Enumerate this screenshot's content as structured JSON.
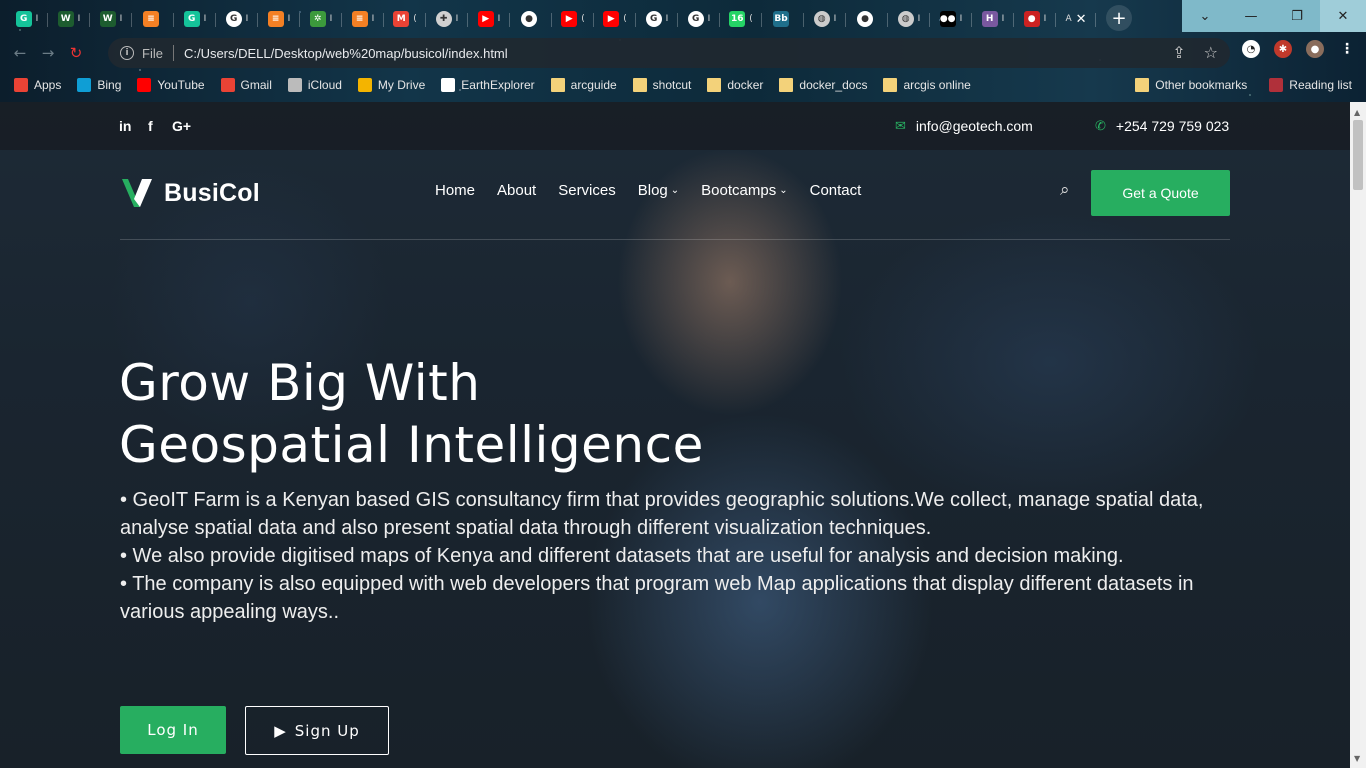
{
  "browser": {
    "tabs": [
      {
        "icon": "grammarly-icon",
        "color": "#15c39a",
        "glyph": "G",
        "text": "I"
      },
      {
        "icon": "wix-icon",
        "color": "#1d5c2f",
        "glyph": "W",
        "text": "I"
      },
      {
        "icon": "wix-icon",
        "color": "#1d5c2f",
        "glyph": "W",
        "text": "I"
      },
      {
        "icon": "stackoverflow-icon",
        "color": "#f48024",
        "glyph": "≡",
        "text": ""
      },
      {
        "icon": "grammarly-icon",
        "color": "#15c39a",
        "glyph": "G",
        "text": "I"
      },
      {
        "icon": "google-icon",
        "color": "#ffffff",
        "glyph": "G",
        "text": "I"
      },
      {
        "icon": "stackoverflow-icon",
        "color": "#f48024",
        "glyph": "≡",
        "text": "I"
      },
      {
        "icon": "plant-icon",
        "color": "#3c9a3c",
        "glyph": "✲",
        "text": "I"
      },
      {
        "icon": "stackoverflow-icon",
        "color": "#f48024",
        "glyph": "≡",
        "text": "I"
      },
      {
        "icon": "gmail-icon",
        "color": "#ea4335",
        "glyph": "M",
        "text": "("
      },
      {
        "icon": "puzzle-icon",
        "color": "#d0d0d0",
        "glyph": "✚",
        "text": "I"
      },
      {
        "icon": "youtube-icon",
        "color": "#ff0000",
        "glyph": "▶",
        "text": "I"
      },
      {
        "icon": "github-icon",
        "color": "#ffffff",
        "glyph": "●",
        "text": ""
      },
      {
        "icon": "youtube-icon",
        "color": "#ff0000",
        "glyph": "▶",
        "text": "("
      },
      {
        "icon": "youtube-icon",
        "color": "#ff0000",
        "glyph": "▶",
        "text": "("
      },
      {
        "icon": "google-icon",
        "color": "#ffffff",
        "glyph": "G",
        "text": "I"
      },
      {
        "icon": "google-icon",
        "color": "#ffffff",
        "glyph": "G",
        "text": "I"
      },
      {
        "icon": "whatsapp-icon",
        "color": "#25d366",
        "glyph": "16",
        "text": "("
      },
      {
        "icon": "bb-icon",
        "color": "#1f6f8b",
        "glyph": "Bb",
        "text": ""
      },
      {
        "icon": "globe-icon",
        "color": "#cccccc",
        "glyph": "◍",
        "text": "I"
      },
      {
        "icon": "github-icon",
        "color": "#ffffff",
        "glyph": "●",
        "text": ""
      },
      {
        "icon": "globe-icon",
        "color": "#cccccc",
        "glyph": "◍",
        "text": "I"
      },
      {
        "icon": "medium-icon",
        "color": "#000000",
        "glyph": "●●",
        "text": "I"
      },
      {
        "icon": "heroku-icon",
        "color": "#79589f",
        "glyph": "H",
        "text": "I"
      },
      {
        "icon": "record-icon",
        "color": "#cc2222",
        "glyph": "●",
        "text": "I"
      }
    ],
    "active_tab": {
      "label": "A",
      "close": "✕"
    },
    "newtab_label": "+",
    "window": {
      "minimize": "—",
      "restore": "❐",
      "close": "✕",
      "dropdown": "⌄"
    },
    "nav": {
      "back": "←",
      "forward": "→",
      "reload": "↻"
    },
    "address": {
      "scheme": "File",
      "url": "C:/Users/DELL/Desktop/web%20map/busicol/index.html"
    },
    "bookmarks": [
      {
        "label": "Apps",
        "icon": "apps-icon",
        "color": "#ea4335"
      },
      {
        "label": "Bing",
        "icon": "bing-icon",
        "color": "#0f9ed5"
      },
      {
        "label": "YouTube",
        "icon": "youtube-icon",
        "color": "#ff0000"
      },
      {
        "label": "Gmail",
        "icon": "gmail-icon",
        "color": "#ea4335"
      },
      {
        "label": "iCloud",
        "icon": "apple-icon",
        "color": "#bbbbbb"
      },
      {
        "label": "My Drive",
        "icon": "drive-icon",
        "color": "#f4b400"
      },
      {
        "label": "EarthExplorer",
        "icon": "ee-icon",
        "color": "#ffffff"
      },
      {
        "label": "arcguide",
        "icon": "folder-icon",
        "color": "#f3d27a"
      },
      {
        "label": "shotcut",
        "icon": "folder-icon",
        "color": "#f3d27a"
      },
      {
        "label": "docker",
        "icon": "folder-icon",
        "color": "#f3d27a"
      },
      {
        "label": "docker_docs",
        "icon": "folder-icon",
        "color": "#f3d27a"
      },
      {
        "label": "arcgis online",
        "icon": "folder-icon",
        "color": "#f3d27a"
      }
    ],
    "bookmarks_right": [
      {
        "label": "Other bookmarks",
        "icon": "folder-icon"
      },
      {
        "label": "Reading list",
        "icon": "reading-list-icon"
      }
    ]
  },
  "site": {
    "accent": "#27ae60",
    "socials": [
      "in",
      "f",
      "G+"
    ],
    "email": "info@geotech.com",
    "phone": "+254 729 759 023",
    "brand": "BusiCol",
    "menu": [
      {
        "label": "Home",
        "dropdown": false
      },
      {
        "label": "About",
        "dropdown": false
      },
      {
        "label": "Services",
        "dropdown": false
      },
      {
        "label": "Blog",
        "dropdown": true
      },
      {
        "label": "Bootcamps",
        "dropdown": true
      },
      {
        "label": "Contact",
        "dropdown": false
      }
    ],
    "quote_button": "Get a Quote",
    "hero": {
      "title_line1": "Grow Big With",
      "title_line2": "Geospatial Intelligence",
      "para1": "• GeoIT Farm is a Kenyan based GIS consultancy firm that provides geographic solutions.We collect, manage spatial data,",
      "para2": "analyse spatial data and also present spatial data through different visualization techniques.",
      "para3": "• We also provide digitised maps of Kenya and different datasets that are useful for analysis and decision making.",
      "para4": "• The company is also equipped with web developers that program web Map applications that display different datasets in various appealing ways..",
      "login": "Log In",
      "signup": "Sign Up"
    }
  }
}
